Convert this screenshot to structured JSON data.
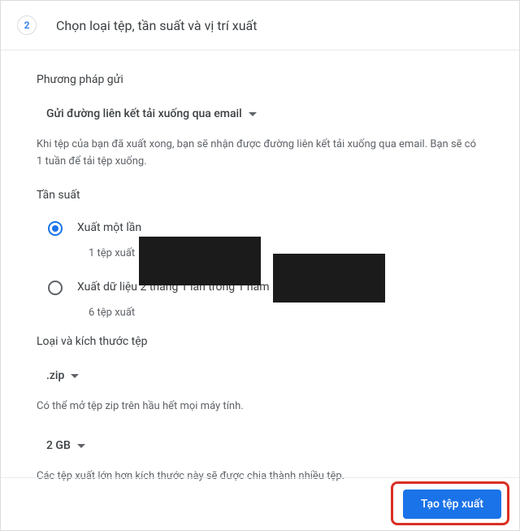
{
  "header": {
    "step_number": "2",
    "title": "Chọn loại tệp, tần suất và vị trí xuất"
  },
  "delivery": {
    "section_title": "Phương pháp gửi",
    "selected": "Gửi đường liên kết tải xuống qua email",
    "helper": "Khi tệp của bạn đã xuất xong, bạn sẽ nhận được đường liên kết tải xuống qua email. Bạn sẽ có 1 tuần để tải tệp xuống."
  },
  "frequency": {
    "section_title": "Tần suất",
    "options": [
      {
        "label": "Xuất một lần",
        "sub": "1 tệp xuất",
        "selected": true
      },
      {
        "label": "Xuất dữ liệu 2 tháng 1 lần trong 1 năm",
        "sub": "6 tệp xuất",
        "selected": false
      }
    ]
  },
  "filetype": {
    "section_title": "Loại và kích thước tệp",
    "type_selected": ".zip",
    "type_helper": "Có thể mở tệp zip trên hầu hết mọi máy tính.",
    "size_selected": "2 GB",
    "size_helper": "Các tệp xuất lớn hơn kích thước này sẽ được chia thành nhiều tệp."
  },
  "footer": {
    "create_label": "Tạo tệp xuất"
  }
}
